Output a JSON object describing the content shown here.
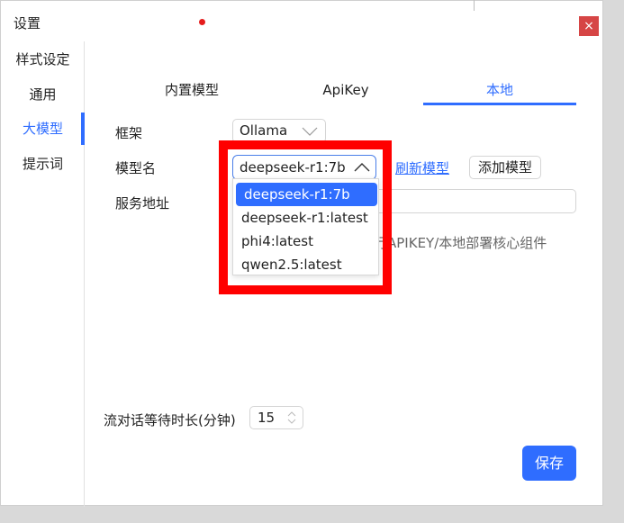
{
  "window": {
    "title": "设置",
    "close_label": "×"
  },
  "sidebar": {
    "items": [
      {
        "label": "样式设定"
      },
      {
        "label": "通用"
      },
      {
        "label": "大模型"
      },
      {
        "label": "提示词"
      }
    ]
  },
  "tabs": [
    {
      "label": "内置模型"
    },
    {
      "label": "ApiKey"
    },
    {
      "label": "本地"
    }
  ],
  "form": {
    "framework_label": "框架",
    "framework_value": "Ollama",
    "model_label": "模型名",
    "model_value": "deepseek-r1:7b",
    "refresh_label": "刷新模型",
    "add_label": "添加模型",
    "service_label": "服务地址",
    "hint": "行APIKEY/本地部署核心组件"
  },
  "dropdown": {
    "options": [
      "deepseek-r1:7b",
      "deepseek-r1:latest",
      "phi4:latest",
      "qwen2.5:latest"
    ]
  },
  "duration": {
    "label": "流对话等待时长(分钟)",
    "value": "15"
  },
  "actions": {
    "save_label": "保存"
  },
  "colors": {
    "accent": "#2f6dff",
    "highlight": "#ff0000",
    "close": "#d64545"
  }
}
